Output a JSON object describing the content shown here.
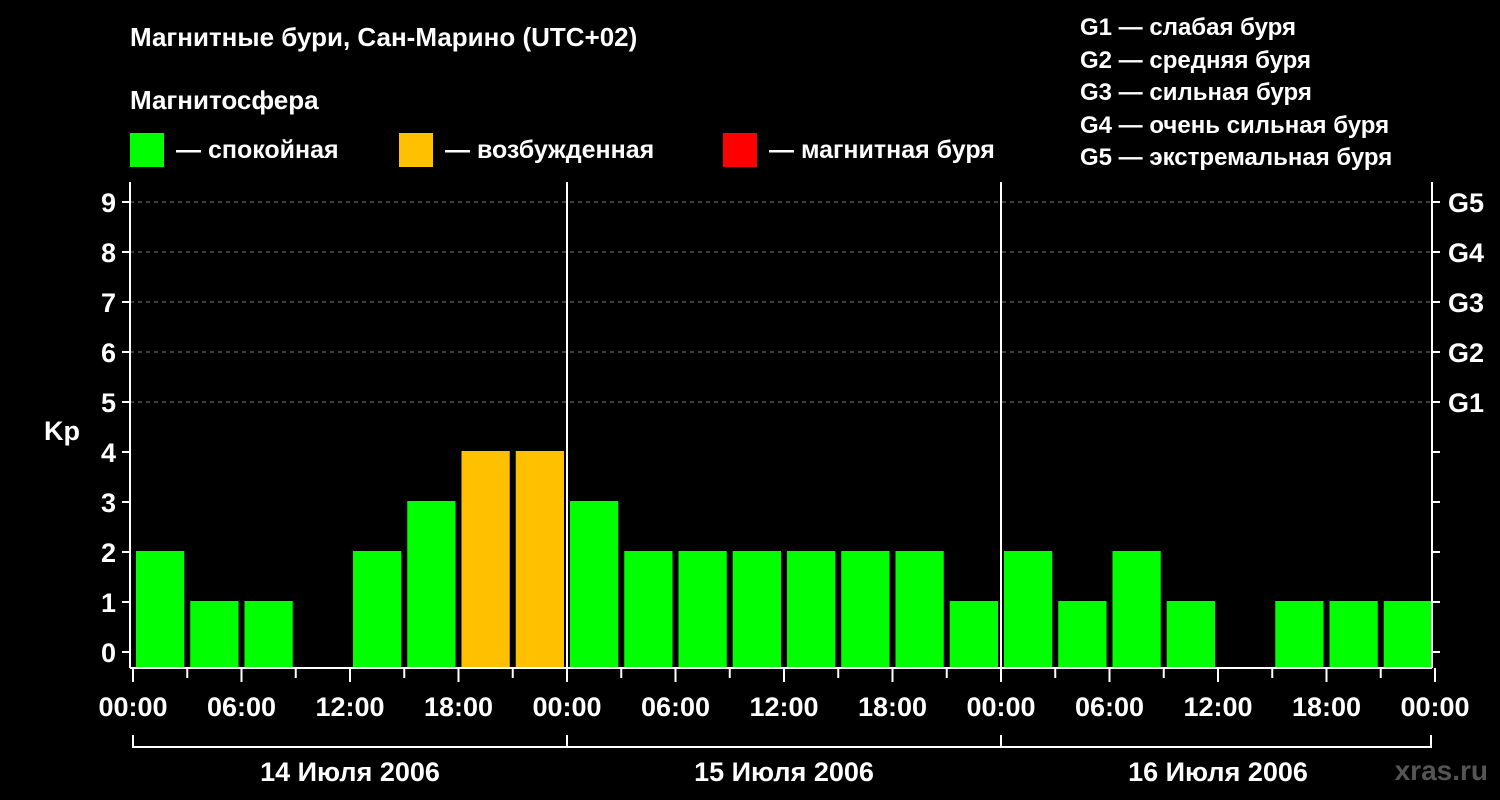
{
  "title": "Магнитные бури, Сан-Марино (UTC+02)",
  "subtitle": "Магнитосфера",
  "legend": [
    {
      "label": "— спокойная",
      "color": "#00ff00"
    },
    {
      "label": "— возбужденная",
      "color": "#ffc000"
    },
    {
      "label": "— магнитная буря",
      "color": "#ff0000"
    }
  ],
  "g_legend": [
    "G1 — слабая буря",
    "G2 — средняя буря",
    "G3 — сильная буря",
    "G4 — очень сильная буря",
    "G5 — экстремальная буря"
  ],
  "watermark": "xras.ru",
  "chart_data": {
    "type": "bar",
    "ylabel": "Kp",
    "ylim": [
      0,
      9
    ],
    "yticks": [
      0,
      1,
      2,
      3,
      4,
      5,
      6,
      7,
      8,
      9
    ],
    "right_ticks": [
      {
        "value": 5,
        "label": "G1"
      },
      {
        "value": 6,
        "label": "G2"
      },
      {
        "value": 7,
        "label": "G3"
      },
      {
        "value": 8,
        "label": "G4"
      },
      {
        "value": 9,
        "label": "G5"
      }
    ],
    "grid": "dashed horizontal at 5–9",
    "x_tick_labels": [
      "00:00",
      "06:00",
      "12:00",
      "18:00",
      "00:00",
      "06:00",
      "12:00",
      "18:00",
      "00:00",
      "06:00",
      "12:00",
      "18:00",
      "00:00"
    ],
    "days": [
      "14 Июля 2006",
      "15 Июля 2006",
      "16 Июля 2006"
    ],
    "categories": [
      "14.07 00:00",
      "14.07 03:00",
      "14.07 06:00",
      "14.07 09:00",
      "14.07 12:00",
      "14.07 15:00",
      "14.07 18:00",
      "14.07 21:00",
      "15.07 00:00",
      "15.07 03:00",
      "15.07 06:00",
      "15.07 09:00",
      "15.07 12:00",
      "15.07 15:00",
      "15.07 18:00",
      "15.07 21:00",
      "16.07 00:00",
      "16.07 03:00",
      "16.07 06:00",
      "16.07 09:00",
      "16.07 12:00",
      "16.07 15:00",
      "16.07 18:00",
      "16.07 21:00"
    ],
    "values": [
      2,
      1,
      1,
      0,
      2,
      3,
      4,
      4,
      3,
      2,
      2,
      2,
      2,
      2,
      2,
      1,
      2,
      1,
      2,
      1,
      0,
      1,
      1,
      1
    ],
    "colors": {
      "quiet": "#00ff00",
      "active": "#ffc000",
      "storm": "#ff0000"
    }
  }
}
